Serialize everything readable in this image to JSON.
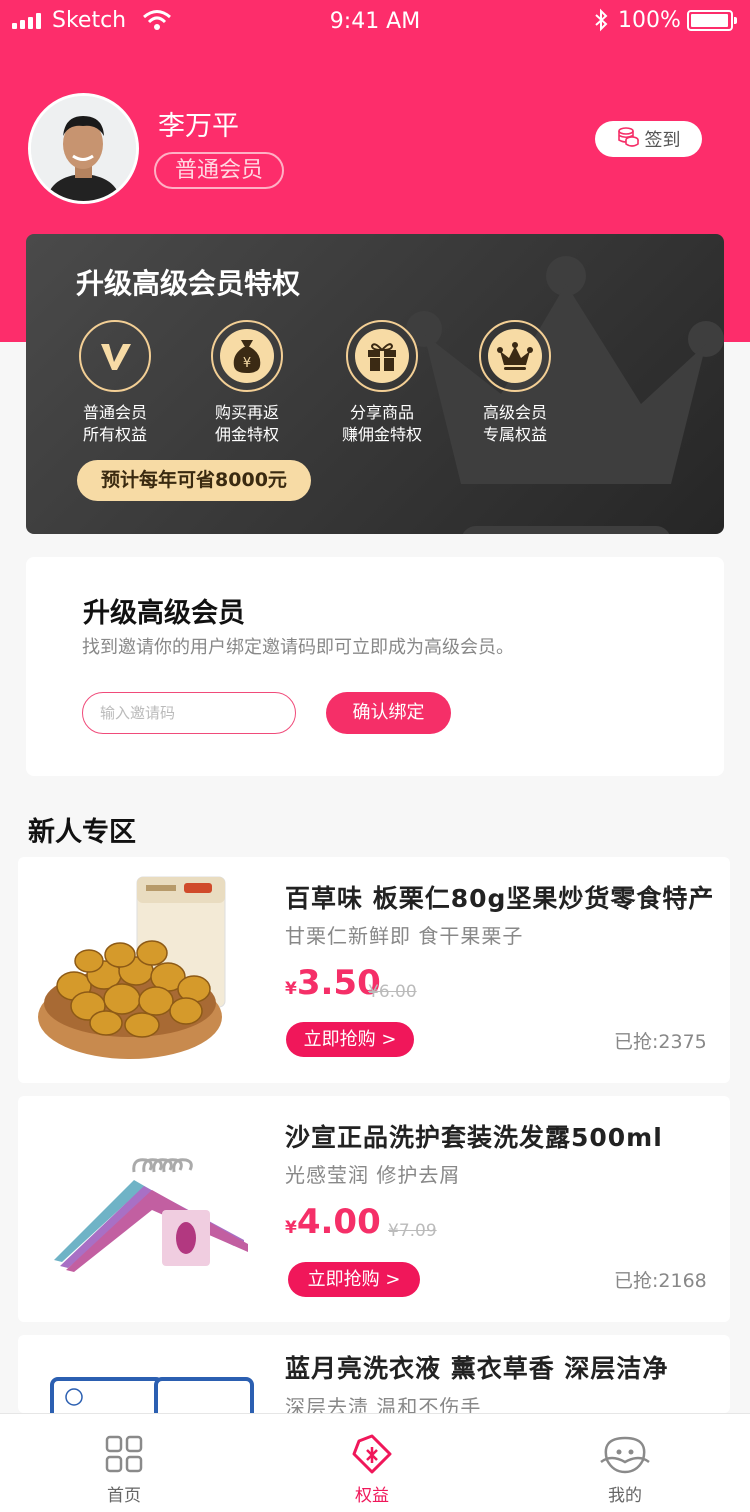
{
  "status_bar": {
    "carrier": "Sketch",
    "time": "9:41 AM",
    "battery": "100%"
  },
  "profile": {
    "name": "李万平",
    "level": "普通会员",
    "sign_in": "签到"
  },
  "vip_card": {
    "title": "升级高级会员特权",
    "perks": [
      {
        "line1": "普通会员",
        "line2": "所有权益",
        "icon": "v-icon"
      },
      {
        "line1": "购买再返",
        "line2": "佣金特权",
        "icon": "money-bag-icon"
      },
      {
        "line1": "分享商品",
        "line2": "赚佣金特权",
        "icon": "gift-icon"
      },
      {
        "line1": "高级会员",
        "line2": "专属权益",
        "icon": "crown-icon"
      }
    ],
    "savings": "预计每年可省8000元"
  },
  "invite": {
    "title": "升级高级会员",
    "subtitle": "找到邀请你的用户绑定邀请码即可立即成为高级会员。",
    "placeholder": "输入邀请码",
    "confirm": "确认绑定"
  },
  "section": {
    "title": "新人专区"
  },
  "products": [
    {
      "name": "百草味 板栗仁80g坚果炒货零食特产",
      "desc": "甘栗仁新鲜即  食干果栗子",
      "currency": "¥",
      "price": "3.50",
      "original": "¥6.00",
      "buy": "立即抢购 >",
      "sold_label": "已抢:",
      "sold": "2375"
    },
    {
      "name": "沙宣正品洗护套装洗发露500ml",
      "desc": "光感莹润  修护去屑",
      "currency": "¥",
      "price": "4.00",
      "original": "¥7.09",
      "buy": "立即抢购 >",
      "sold_label": "已抢:",
      "sold": "2168"
    },
    {
      "name": "蓝月亮洗衣液 薰衣草香 深层洁净",
      "desc": "深层去渍 温和不伤手"
    }
  ],
  "tabbar": {
    "items": [
      {
        "label": "首页",
        "icon": "grid-icon"
      },
      {
        "label": "权益",
        "icon": "tag-icon"
      },
      {
        "label": "我的",
        "icon": "face-icon"
      }
    ],
    "active_color": "#f0175a"
  },
  "colors": {
    "brand": "#fd2d6b",
    "gold": "#f7dba5"
  }
}
